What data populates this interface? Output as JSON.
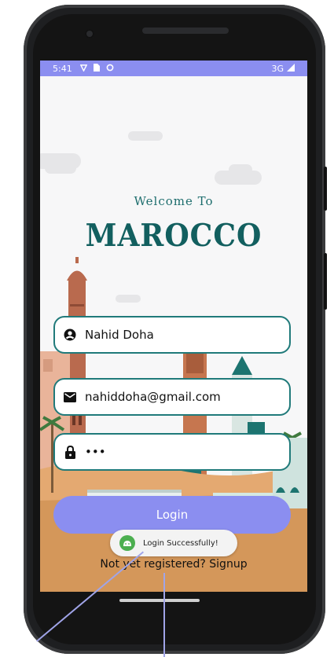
{
  "status_bar": {
    "time": "5:41",
    "network": "3G"
  },
  "header": {
    "welcome": "Welcome To",
    "brand": "MAROCCO"
  },
  "form": {
    "name_value": "Nahid Doha",
    "email_value": "nahiddoha@gmail.com",
    "password_value": "•••",
    "login_label": "Login"
  },
  "signup_text": "Not yet registered? Signup",
  "toast": {
    "message": "Login Successfully!"
  },
  "colors": {
    "accent": "#8b8ef0",
    "field_border": "#207a7a",
    "brand": "#125f5f",
    "ground": "#d4975a"
  },
  "icons": [
    "wifi-icon",
    "sim-card-icon",
    "data-saver-icon",
    "signal-icon",
    "account-circle-icon",
    "mail-icon",
    "lock-icon",
    "android-icon"
  ]
}
